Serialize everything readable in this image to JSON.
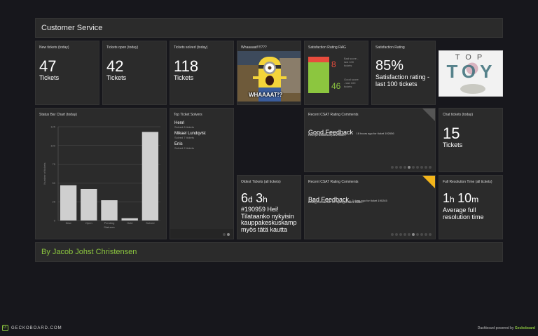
{
  "header": {
    "title": "Customer Service"
  },
  "footer": {
    "title": "By Jacob Johst Christensen"
  },
  "widgets": {
    "new_tickets": {
      "title": "New tickets (today)",
      "value": "47",
      "unit": "Tickets"
    },
    "tickets_open": {
      "title": "Tickets open (today)",
      "value": "42",
      "unit": "Tickets"
    },
    "tickets_solved": {
      "title": "Tickets solved (today)",
      "value": "118",
      "unit": "Tickets"
    },
    "whaat": {
      "title": "Whaaaaat!!!!???",
      "caption": "WHAAAAT!?"
    },
    "rag": {
      "title": "Satisfaction Rating RAG",
      "bad_value": "8",
      "bad_label": "Bad score - last 100 tickets",
      "good_value": "46",
      "good_label": "Good score - last 100 tickets",
      "bad_color": "#e84c3d",
      "good_color": "#8cc63f"
    },
    "satisfaction": {
      "title": "Satisfaction Rating",
      "value": "85%",
      "sub": "Satisfaction rating - last 100 tickets"
    },
    "logo": {
      "line1": "TOP",
      "line2": "TOY"
    },
    "status_chart": {
      "title": "Status Bar Chart (today)"
    },
    "top_solvers": {
      "title": "Top Ticket Solvers",
      "items": [
        {
          "name": "Henri",
          "sub": "Solved 8 tickets"
        },
        {
          "name": "Mikael Lundqvist",
          "sub": "Solved 7 tickets"
        },
        {
          "name": "Enis",
          "sub": "Solved 2 tickets"
        }
      ]
    },
    "csat1": {
      "title": "Recent CSAT Rating Comments",
      "headline": "Good Feedback",
      "meta": "18 hours ago for ticket 192656",
      "comment": "Kiva ja asiallista palvelua!!!"
    },
    "chat": {
      "title": "Chat tickets (today)",
      "value": "15",
      "unit": "Tickets"
    },
    "oldest": {
      "title": "Oldest Tickets (all tickets)",
      "d": "6",
      "d_unit": "d",
      "h": "3",
      "h_unit": "h",
      "text": "#190959 Hei! Tilataanko nykyisin kauppakeskuskamp myös tätä kautta"
    },
    "csat2": {
      "title": "Recent CSAT Rating Comments",
      "headline": "Bad Feedback",
      "meta": "3 days ago for ticket 190245",
      "comment": "Dårlig forståelse for spørgsmålet stillet."
    },
    "resolution": {
      "title": "Full Resolution Time (all tickets)",
      "h": "1",
      "h_unit": "h",
      "m": "10",
      "m_unit": "m",
      "sub": "Average full resolution time"
    }
  },
  "chart_data": {
    "type": "bar",
    "title": "",
    "categories": [
      "New",
      "Open",
      "Pending",
      "Hold",
      "Solved"
    ],
    "values": [
      47,
      42,
      27,
      3,
      118
    ],
    "xlabel": "Statuses",
    "ylabel": "Number of tickets",
    "yticks": [
      0,
      25,
      50,
      75,
      100,
      125
    ],
    "ylim": [
      0,
      125
    ],
    "bar_color": "#cfcfcf",
    "grid": true
  },
  "branding": {
    "left": "GECKOBOARD.COM",
    "right_prefix": "Dashboard powered by",
    "right_brand": "Geckoboard"
  }
}
